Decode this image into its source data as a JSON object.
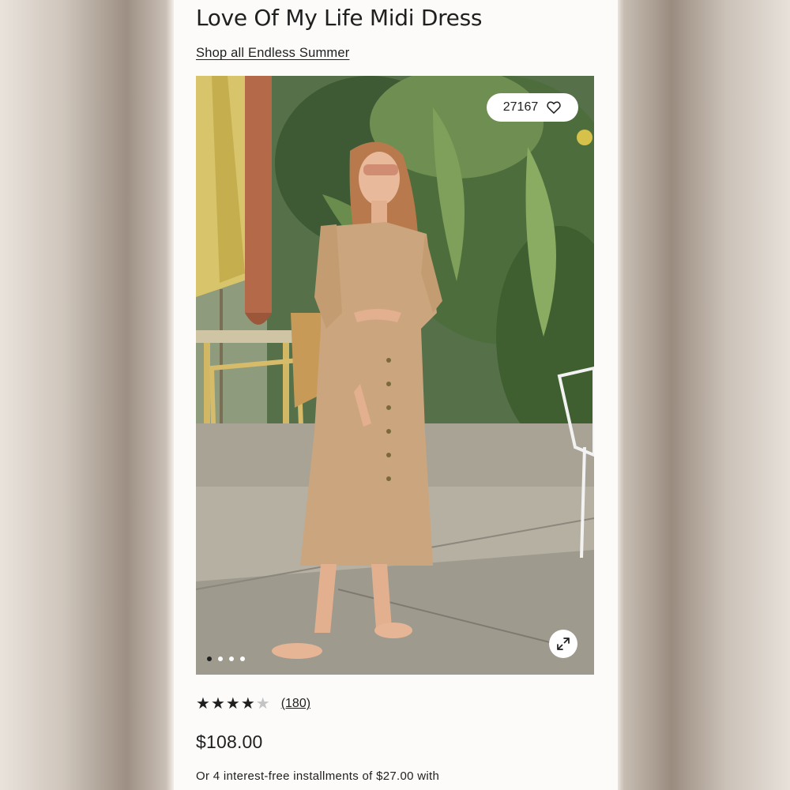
{
  "product": {
    "title": "Love Of My Life Midi Dress",
    "collection_link": "Shop all Endless Summer",
    "favorites_count": "27167",
    "rating": {
      "stars": 4,
      "max": 5,
      "review_count_label": "(180)"
    },
    "price": "$108.00",
    "installments_text": "Or 4 interest-free installments of $27.00 with"
  },
  "gallery": {
    "image_count": 4,
    "active_index": 0,
    "icons": {
      "favorite": "heart-icon",
      "expand": "expand-arrows-icon"
    }
  }
}
